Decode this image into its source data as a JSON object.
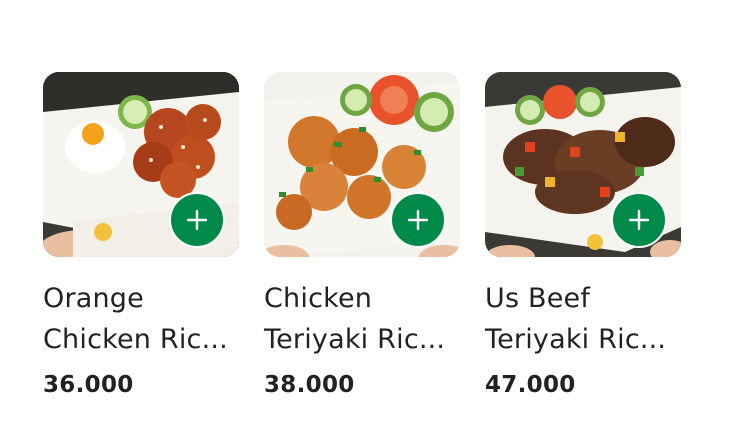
{
  "products": [
    {
      "name_line1": "Orange",
      "name_line2": "Chicken Ric...",
      "price": "36.000",
      "image_icon": "orange-chicken-rice-photo"
    },
    {
      "name_line1": "Chicken",
      "name_line2": "Teriyaki Ric...",
      "price": "38.000",
      "image_icon": "chicken-teriyaki-rice-photo"
    },
    {
      "name_line1": "Us Beef",
      "name_line2": "Teriyaki Ric...",
      "price": "47.000",
      "image_icon": "us-beef-teriyaki-rice-photo"
    }
  ],
  "colors": {
    "add_button": "#008a4a",
    "text": "#222222"
  }
}
